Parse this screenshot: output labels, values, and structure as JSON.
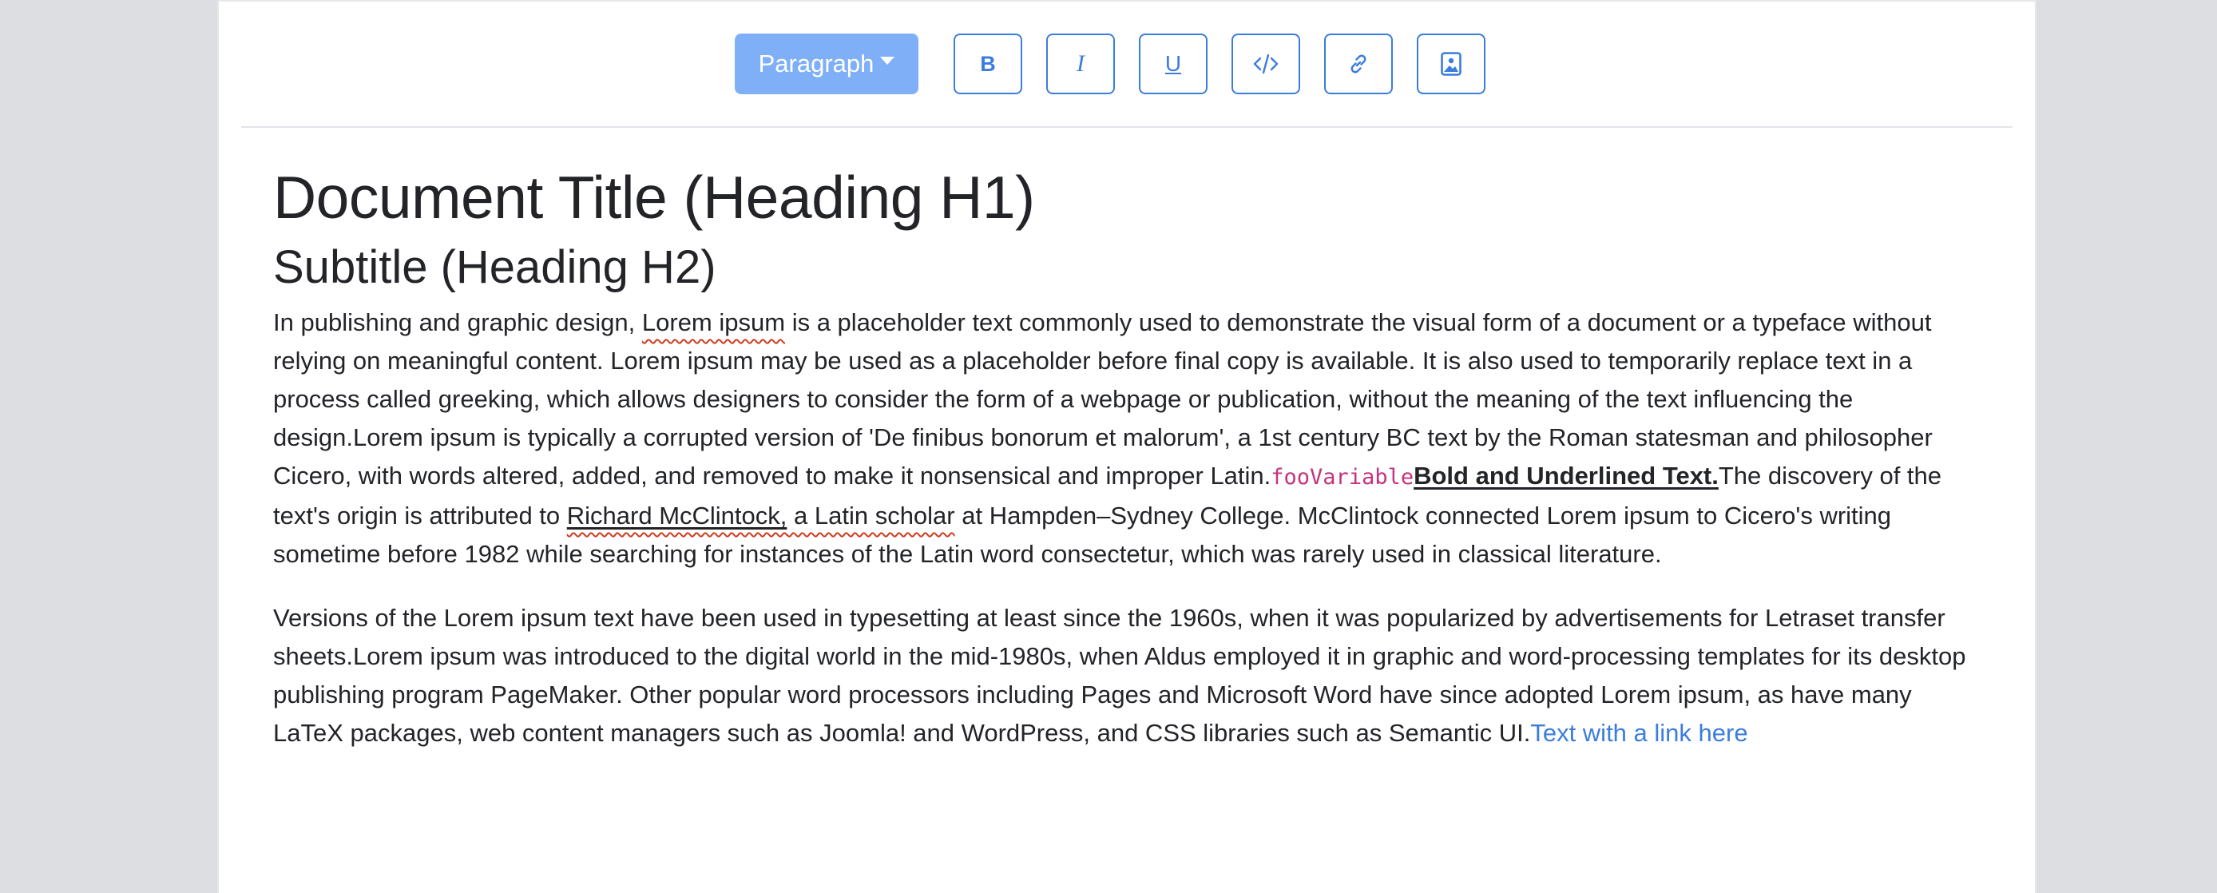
{
  "toolbar": {
    "block_format_label": "Paragraph",
    "bold_label": "B",
    "italic_label": "I",
    "underline_label": "U",
    "icons": {
      "code": "code-icon",
      "link": "link-icon",
      "image": "image-icon"
    },
    "accent_color": "#3b7ddd",
    "active_button_color": "#7fb0f7"
  },
  "document": {
    "title": "Document Title (Heading H1)",
    "subtitle": "Subtitle (Heading H2)",
    "p1": {
      "s1": "In publishing and graphic design, ",
      "spell1": "Lorem ipsum",
      "s2": " is a placeholder text commonly used to demonstrate the visual form of a document or a typeface without relying on meaningful content. Lorem ipsum may be used as a placeholder before final copy is available. It is also used to temporarily replace text in a process called greeking, which allows designers to consider the form of a webpage or publication, without the meaning of the text influencing the design.Lorem ipsum is typically a corrupted version of 'De finibus bonorum et malorum', a 1st century BC text by the Roman statesman and philosopher Cicero, with words altered, added, and removed to make it nonsensical and improper Latin.",
      "code": "fooVariable",
      "bold_underlined": "Bold and Underlined Text.",
      "s3": "The discovery of the text's origin is attributed to ",
      "spell2": "Richard McClintock,",
      "spell2b": " a Latin scholar",
      "s4": " at Hampden–Sydney College. McClintock connected Lorem ipsum to Cicero's writing sometime before 1982 while searching for instances of the Latin word consectetur, which was rarely used in classical literature."
    },
    "p2": {
      "text": "Versions of the Lorem ipsum text have been used in typesetting at least since the 1960s, when it was popularized by advertisements for Letraset transfer sheets.Lorem ipsum was introduced to the digital world in the mid-1980s, when Aldus employed it in graphic and word-processing templates for its desktop publishing program PageMaker. Other popular word processors including Pages and Microsoft Word have since adopted Lorem ipsum, as have many LaTeX packages, web content managers such as Joomla! and WordPress, and CSS libraries such as Semantic UI.",
      "link_text": "Text with a link here"
    },
    "spellcheck_color": "#d03b1f",
    "code_color": "#c4337d",
    "link_color": "#3b7ddd"
  }
}
